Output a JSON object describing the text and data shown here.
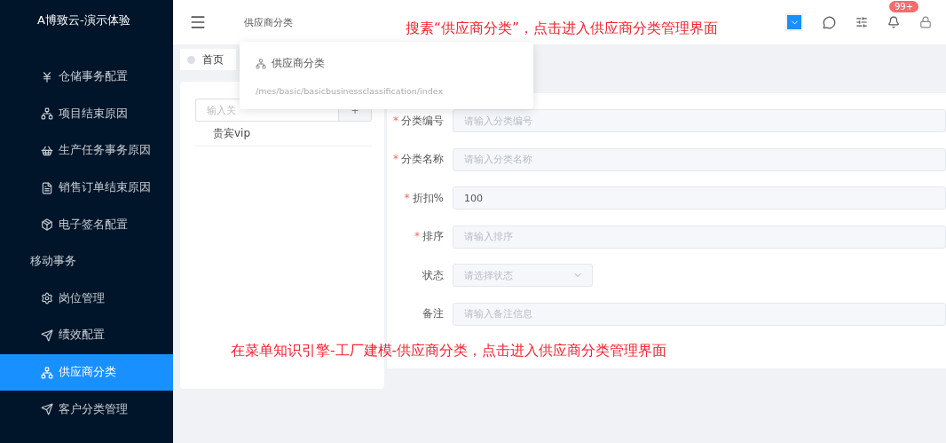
{
  "sidebar": {
    "title": "A博致云-演示体验",
    "items": [
      {
        "label": "仓储事务配置",
        "selected": false
      },
      {
        "label": "项目结束原因",
        "selected": false
      },
      {
        "label": "生产任务事务原因",
        "selected": false
      },
      {
        "label": "销售订单结束原因",
        "selected": false
      },
      {
        "label": "电子签名配置",
        "selected": false
      },
      {
        "label": "移动事务",
        "selected": false
      },
      {
        "label": "岗位管理",
        "selected": false
      },
      {
        "label": "绩效配置",
        "selected": false
      },
      {
        "label": "供应商分类",
        "selected": true
      },
      {
        "label": "客户分类管理",
        "selected": false
      }
    ]
  },
  "header": {
    "search_text": "供应商分类",
    "badge": "99+"
  },
  "search_popover": {
    "title": "供应商分类",
    "path": "/mes/basic/basicbusinessclassification/index"
  },
  "tabs": [
    {
      "label": "首页",
      "selected": false
    }
  ],
  "tree": {
    "placeholder": "输入关",
    "add": "+",
    "nodes": [
      "贵宾vip"
    ]
  },
  "form": {
    "fields": [
      {
        "kind": "input",
        "mark": "*",
        "label": "分类编号",
        "placeholder": "请输入分类编号"
      },
      {
        "kind": "input",
        "mark": "*",
        "label": "分类名称",
        "placeholder": "请输入分类名称"
      },
      {
        "kind": "input",
        "mark": "*",
        "label": "折扣%",
        "value": "100"
      },
      {
        "kind": "input",
        "mark": "*",
        "label": "排序",
        "placeholder": "请输入排序"
      },
      {
        "kind": "select",
        "label": "状态",
        "placeholder": "请选择状态"
      },
      {
        "kind": "input",
        "label": "备注",
        "placeholder": "请输入备注信息"
      }
    ]
  },
  "annotations": [
    "搜素“供应商分类”，点击进入供应商分类管理界面",
    "在菜单知识引擎-工厂建模-供应商分类，点击进入供应商分类管理界面"
  ]
}
